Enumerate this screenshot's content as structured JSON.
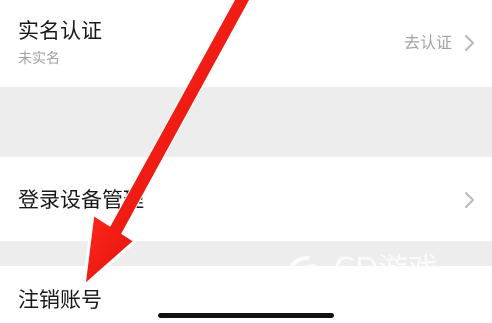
{
  "settings": {
    "real_name": {
      "title": "实名认证",
      "subtitle": "未实名",
      "action": "去认证",
      "action_icon": "chevron-right-icon"
    },
    "device_management": {
      "title": "登录设备管理",
      "action_icon": "chevron-right-icon"
    },
    "cancel_account": {
      "title": "注销账号"
    }
  },
  "watermark": {
    "brand": "CD游戏",
    "url": "www.CD6.COM"
  },
  "colors": {
    "background": "#ededed",
    "row": "#ffffff",
    "primary_text": "#191919",
    "secondary_text": "#a2a2a2",
    "annotation_arrow": "#ee1111"
  }
}
